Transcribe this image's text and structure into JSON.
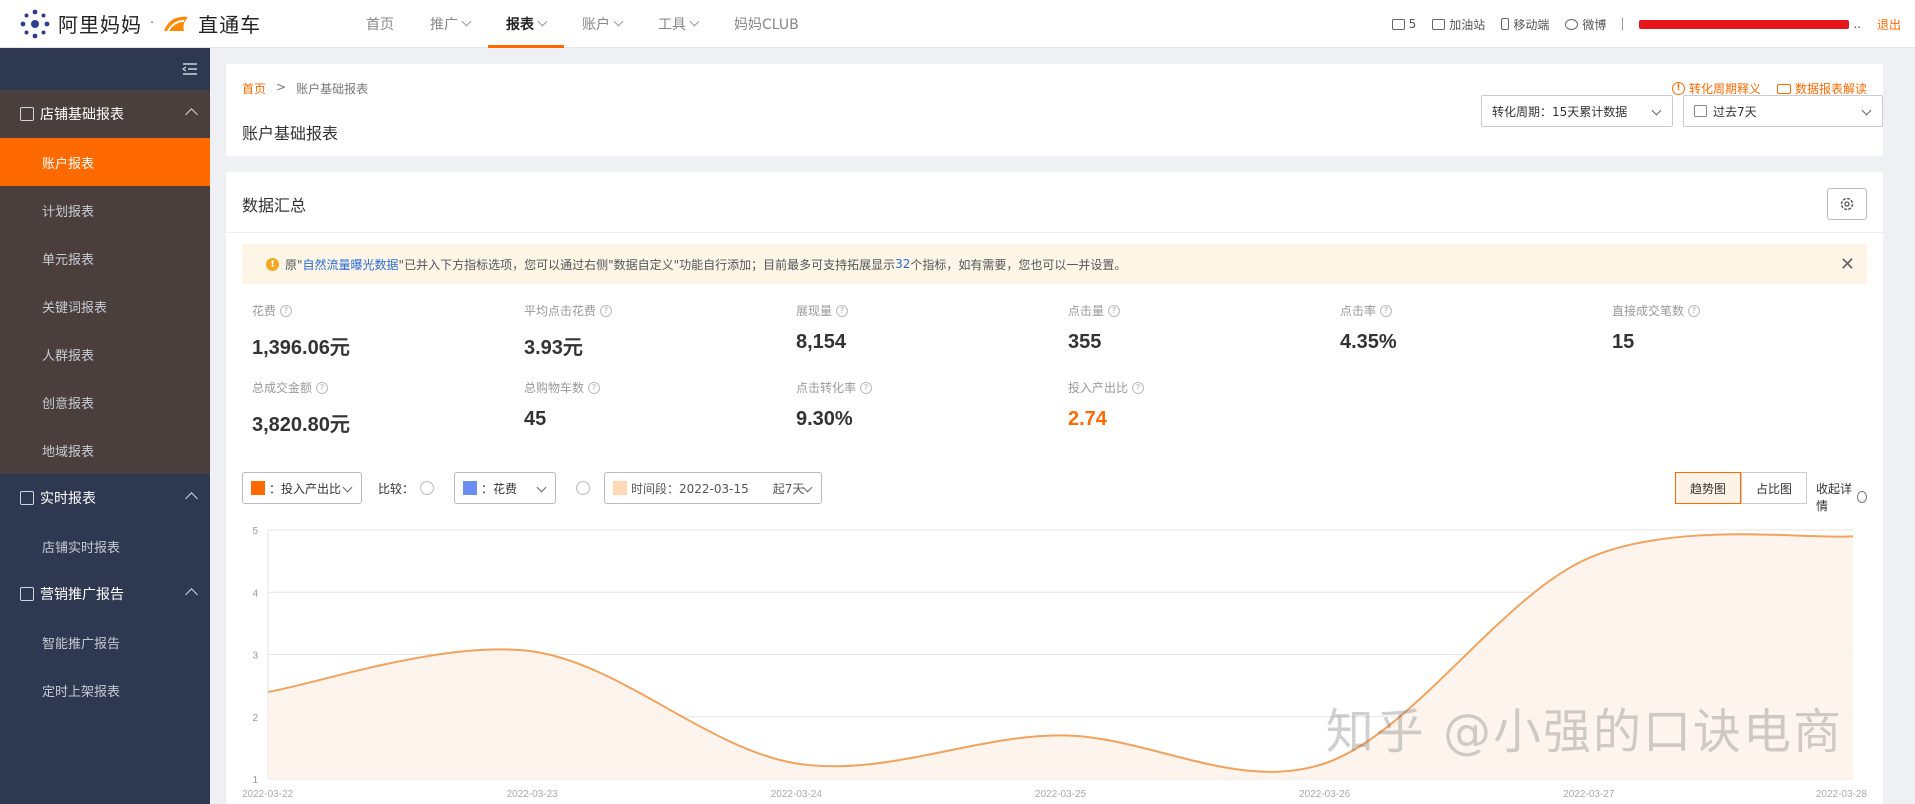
{
  "topbar": {
    "brand_alimama": "阿里妈妈",
    "brand_sep": "·",
    "brand_ztc": "直通车",
    "nav": [
      {
        "label": "首页",
        "caret": false,
        "active": false
      },
      {
        "label": "推广",
        "caret": true,
        "active": false
      },
      {
        "label": "报表",
        "caret": true,
        "active": true
      },
      {
        "label": "账户",
        "caret": true,
        "active": false
      },
      {
        "label": "工具",
        "caret": true,
        "active": false
      },
      {
        "label": "妈妈CLUB",
        "caret": false,
        "active": false
      }
    ],
    "msg_count": "5",
    "favorites": "加油站",
    "mobile": "移动端",
    "weibo": "微博",
    "user_suffix": "..",
    "logout": "退出"
  },
  "sidebar": {
    "groups": [
      {
        "title": "店铺基础报表",
        "items": [
          {
            "label": "账户报表",
            "active": true
          },
          {
            "label": "计划报表",
            "active": false
          },
          {
            "label": "单元报表",
            "active": false
          },
          {
            "label": "关键词报表",
            "active": false
          },
          {
            "label": "人群报表",
            "active": false
          },
          {
            "label": "创意报表",
            "active": false
          },
          {
            "label": "地域报表",
            "active": false
          }
        ]
      },
      {
        "title": "实时报表",
        "items": [
          {
            "label": "店铺实时报表",
            "active": false
          }
        ]
      },
      {
        "title": "营销推广报告",
        "items": [
          {
            "label": "智能推广报告",
            "active": false
          },
          {
            "label": "定时上架报表",
            "active": false
          }
        ]
      }
    ]
  },
  "header": {
    "breadcrumb_home": "首页",
    "breadcrumb_sep": ">",
    "breadcrumb_current": "账户基础报表",
    "title": "账户基础报表",
    "link_cycle": "转化周期释义",
    "link_report": "数据报表解读",
    "cycle_select": "转化周期：15天累计数据",
    "date_select": "过去7天"
  },
  "summary": {
    "title": "数据汇总",
    "notice_prefix": "原\"",
    "notice_highlight": "自然流量曝光数据",
    "notice_mid": "\"已并入下方指标选项，您可以通过右侧\"数据自定义\"功能自行添加；目前最多可支持拓展显示",
    "notice_count": "32",
    "notice_suffix": "个指标，如有需要，您也可以一并设置。",
    "metrics": [
      {
        "label": "花费",
        "value": "1,396.06元",
        "highlight": false
      },
      {
        "label": "平均点击花费",
        "value": "3.93元",
        "highlight": false
      },
      {
        "label": "展现量",
        "value": "8,154",
        "highlight": false
      },
      {
        "label": "点击量",
        "value": "355",
        "highlight": false
      },
      {
        "label": "点击率",
        "value": "4.35%",
        "highlight": false
      },
      {
        "label": "直接成交笔数",
        "value": "15",
        "highlight": false
      },
      {
        "label": "总成交金额",
        "value": "3,820.80元",
        "highlight": false
      },
      {
        "label": "总购物车数",
        "value": "45",
        "highlight": false
      },
      {
        "label": "点击转化率",
        "value": "9.30%",
        "highlight": false
      },
      {
        "label": "投入产出比",
        "value": "2.74",
        "highlight": true
      }
    ]
  },
  "controls": {
    "metric1": "：投入产出比",
    "metric1_color": "#ff6a00",
    "compare_label": "比较：",
    "metric2": "：花费",
    "metric2_color": "#6b8cf0",
    "period_label": "时间段：2022-03-15",
    "period_suffix": "起7天",
    "period_color": "#ffd9b8",
    "view_trend": "趋势图",
    "view_ratio": "占比图",
    "collapse": "收起详情"
  },
  "chart_data": {
    "type": "area",
    "x": [
      "2022-03-22",
      "2022-03-23",
      "2022-03-24",
      "2022-03-25",
      "2022-03-26",
      "2022-03-27",
      "2022-03-28"
    ],
    "series": [
      {
        "name": "投入产出比",
        "values": [
          2.4,
          3.05,
          1.25,
          1.7,
          1.25,
          4.55,
          4.9
        ],
        "color": "#f2a25c"
      }
    ],
    "ylim": [
      1,
      5
    ],
    "yticks": [
      "1",
      "2",
      "3",
      "4",
      "5"
    ],
    "grid": true
  },
  "watermark": "知乎 @小强的口诀电商"
}
